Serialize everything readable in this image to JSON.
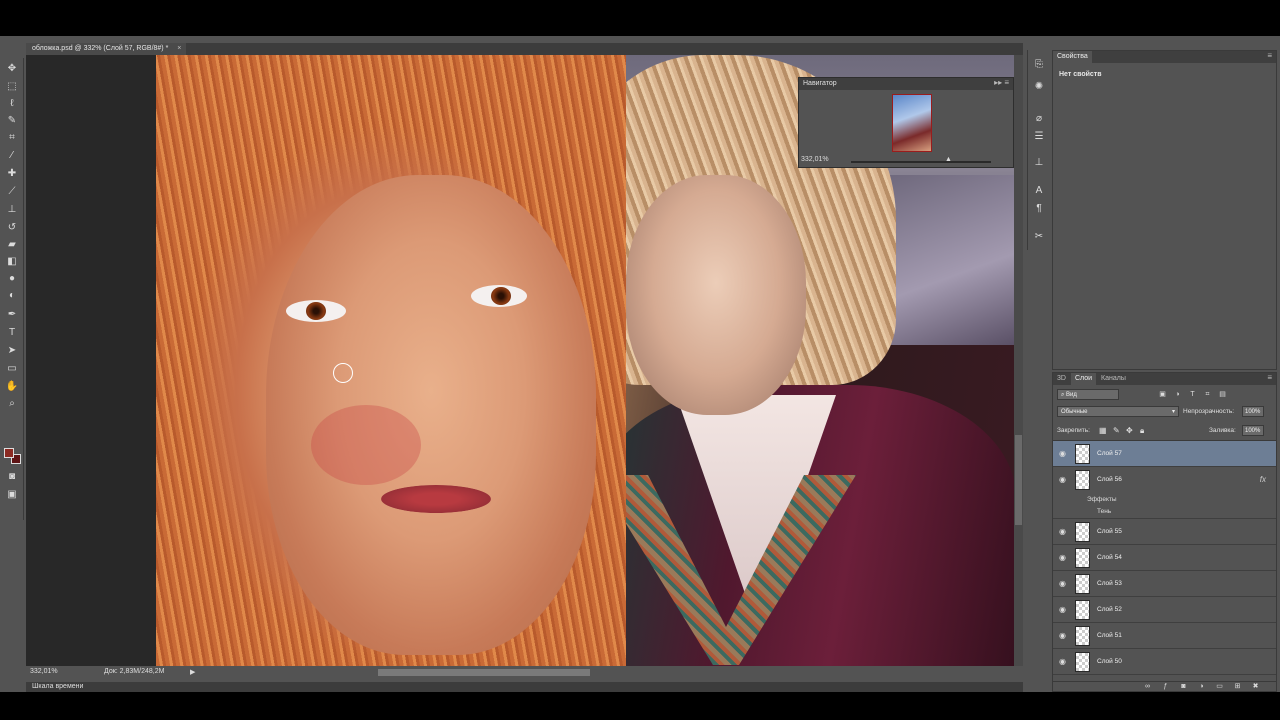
{
  "document": {
    "tab_label": "обложка.psd @ 332% (Слой 57, RGB/8#) *"
  },
  "toolbar": {
    "tools": [
      "move-tool",
      "marquee-tool",
      "lasso-tool",
      "quick-select-tool",
      "crop-tool",
      "eyedropper-tool",
      "healing-tool",
      "brush-tool",
      "stamp-tool",
      "history-brush-tool",
      "eraser-tool",
      "gradient-tool",
      "blur-tool",
      "dodge-tool",
      "pen-tool",
      "type-tool",
      "path-select-tool",
      "shape-tool",
      "hand-tool",
      "zoom-tool"
    ],
    "fg_color": "#8b2a22",
    "bg_color": "#5e1415"
  },
  "navigator": {
    "title": "Навигатор",
    "zoom": "332,01%"
  },
  "status": {
    "zoom": "332,01%",
    "doc_size": "Док: 2,83M/248,2M"
  },
  "timeline": {
    "label": "Шкала времени"
  },
  "properties": {
    "tab": "Свойства",
    "empty_text": "Нет свойств"
  },
  "layers": {
    "tabs": [
      "3D",
      "Слои",
      "Каналы"
    ],
    "filter": "Вид",
    "blend_mode": "Обычные",
    "opacity_label": "Непрозрачность:",
    "opacity": "100%",
    "lock_label": "Закрепить:",
    "fill_label": "Заливка:",
    "fill": "100%",
    "effects_label": "Эффекты",
    "shadow_label": "Тень",
    "items": [
      {
        "name": "Слой 57"
      },
      {
        "name": "Слой 56"
      },
      {
        "name": "Слой 55"
      },
      {
        "name": "Слой 54"
      },
      {
        "name": "Слой 53"
      },
      {
        "name": "Слой 52"
      },
      {
        "name": "Слой 51"
      },
      {
        "name": "Слой 50"
      }
    ]
  }
}
